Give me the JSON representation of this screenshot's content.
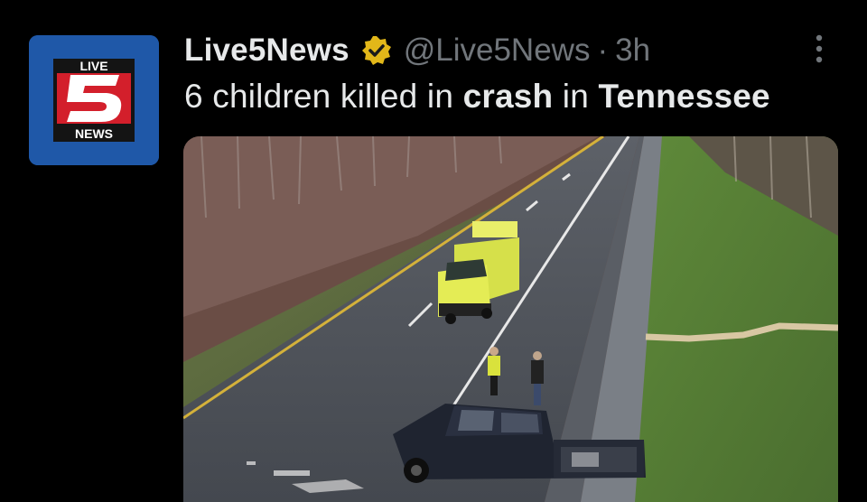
{
  "tweet": {
    "display_name": "Live5News",
    "handle": "@Live5News",
    "separator": "·",
    "time": "3h",
    "text_parts": [
      "6 children killed in ",
      "crash",
      " in ",
      "Tennessee"
    ],
    "verified_color": "#e2b719"
  },
  "avatar": {
    "top_label": "LIVE",
    "number": "5",
    "bottom_label": "NEWS",
    "background": "#1f58a8",
    "accent": "#d31f2b"
  },
  "icons": {
    "verified": "verified-badge-icon",
    "more": "more-options-icon"
  },
  "media": {
    "description_icon": "crash-scene-photo"
  }
}
